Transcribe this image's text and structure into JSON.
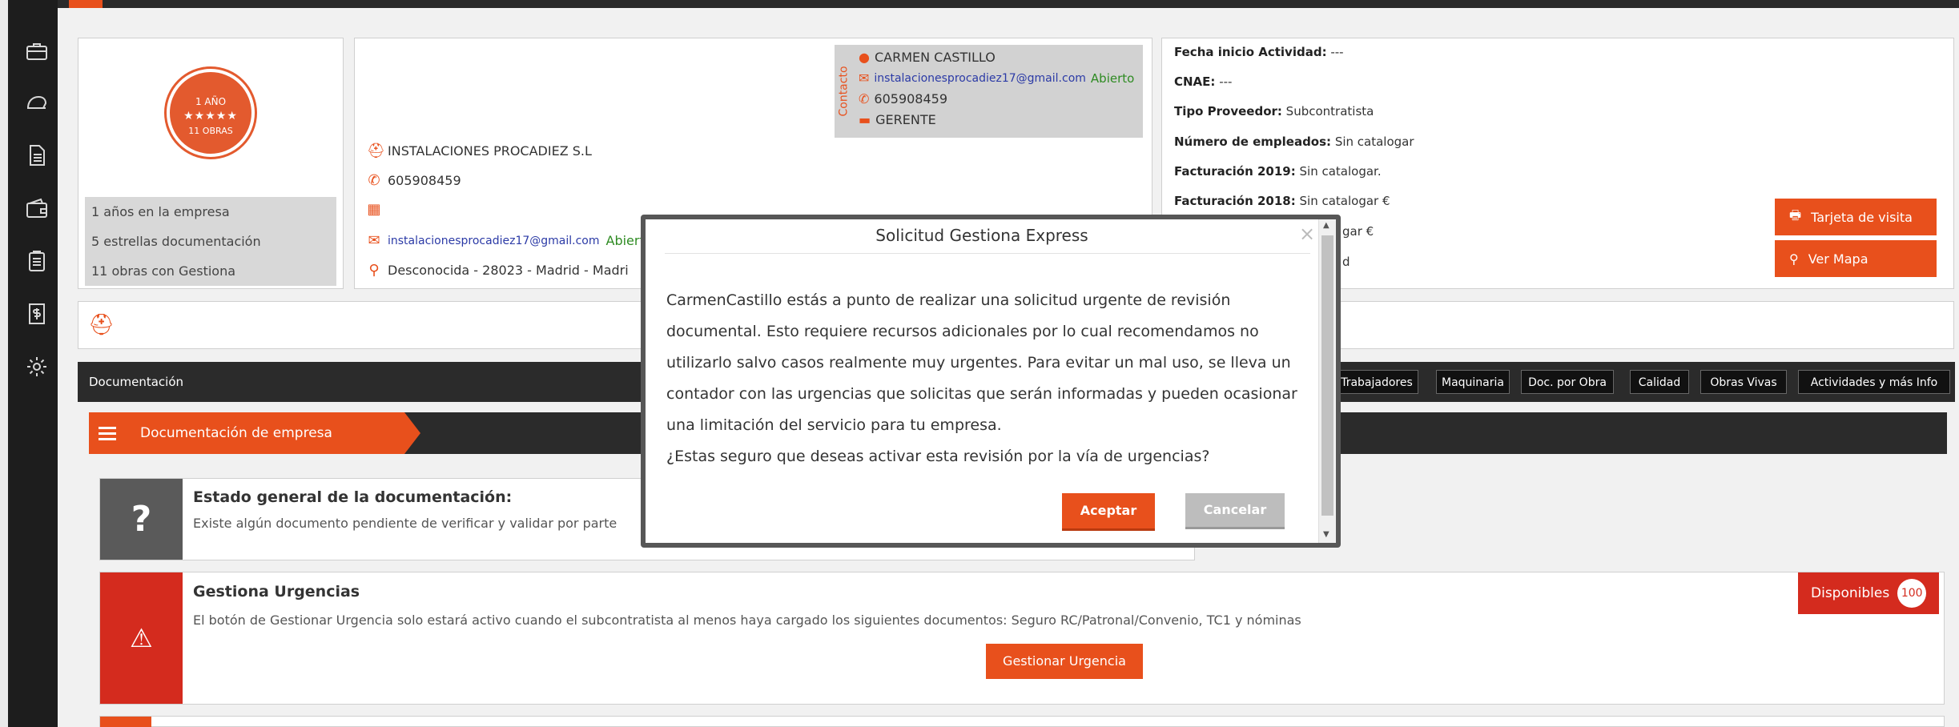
{
  "badge": {
    "years": "1 AÑO",
    "stars": "★★★★★",
    "works": "11 OBRAS"
  },
  "stats": [
    "1 años en la empresa",
    "5 estrellas documentación",
    "11 obras con Gestiona"
  ],
  "company": {
    "name": "INSTALACIONES PROCADIEZ S.L",
    "phone": "605908459",
    "email": "instalacionesprocadiez17@gmail.com",
    "email_status": "Abierto",
    "address": "Desconocida - 28023 - Madrid - Madri"
  },
  "contact": {
    "side_label": "Contacto",
    "name": "CARMEN CASTILLO",
    "email": "instalacionesprocadiez17@gmail.com",
    "email_status": "Abierto",
    "phone": "605908459",
    "role": "GERENTE"
  },
  "facts": [
    {
      "label": "Fecha inicio Actividad:",
      "value": " ---"
    },
    {
      "label": "CNAE:",
      "value": " ---"
    },
    {
      "label": "Tipo Proveedor:",
      "value": " Subcontratista"
    },
    {
      "label": "Número de empleados:",
      "value": " Sin catalogar"
    },
    {
      "label": "Facturación 2019:",
      "value": " Sin catalogar."
    },
    {
      "label": "Facturación 2018:",
      "value": " Sin catalogar €"
    },
    {
      "label": "",
      "value": "gar €"
    },
    {
      "label": "",
      "value": "d"
    }
  ],
  "buttons": {
    "card": "Tarjeta de visita",
    "map": "Ver Mapa"
  },
  "tabs": {
    "active": "Documentación",
    "items": [
      "Trabajadores",
      "Maquinaria",
      "Doc. por Obra",
      "Calidad",
      "Obras Vivas",
      "Actividades y más Info"
    ]
  },
  "section": {
    "title": "Documentación de empresa"
  },
  "status_card": {
    "title": "Estado general de la documentación:",
    "desc": "Existe algún documento pendiente de verificar y validar por parte"
  },
  "urgent_card": {
    "title": "Gestiona Urgencias",
    "desc": "El botón de Gestionar Urgencia solo estará activo cuando el subcontratista al menos haya cargado los siguientes documentos: Seguro RC/Patronal/Convenio, TC1 y nóminas",
    "button": "Gestionar Urgencia",
    "available_label": "Disponibles",
    "available_count": "100"
  },
  "modal": {
    "title": "Solicitud Gestiona Express",
    "close": "×",
    "lines": [
      "CarmenCastillo estás a punto de realizar una solicitud urgente de revisión",
      "documental. Esto requiere recursos adicionales por lo cual recomendamos no",
      "utilizarlo salvo casos realmente muy urgentes. Para evitar un mal uso, se lleva un",
      "contador con las urgencias que solicitas que serán informadas y pueden ocasionar",
      "una limitación del servicio para tu empresa.",
      "¿Estas seguro que deseas activar esta revisión por la vía de urgencias?"
    ],
    "accept": "Aceptar",
    "cancel": "Cancelar"
  },
  "colors": {
    "accent": "#e8501c",
    "dark": "#2b2b2b",
    "sidebar": "#1d1d1d"
  }
}
